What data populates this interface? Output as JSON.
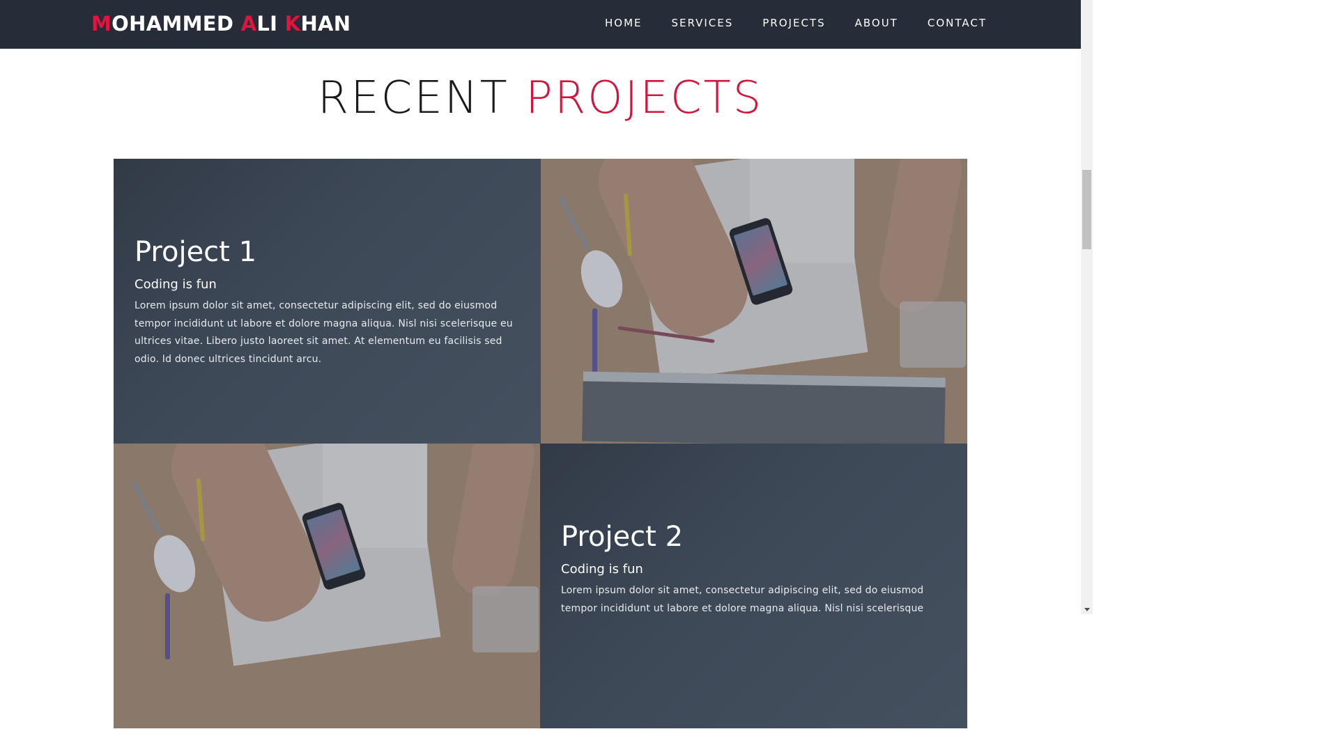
{
  "nav": {
    "brand": {
      "part1_accent": "M",
      "part1_rest": "OHAMMED ",
      "part2_accent": "A",
      "part2_rest": "LI ",
      "part3_accent": "K",
      "part3_rest": "HAN"
    },
    "links": [
      "HOME",
      "SERVICES",
      "PROJECTS",
      "ABOUT",
      "CONTACT"
    ]
  },
  "section": {
    "title_plain": "RECENT",
    "title_accent": "PROJECTS"
  },
  "projects": [
    {
      "title": "Project 1",
      "subtitle": "Coding is fun",
      "description": "Lorem ipsum dolor sit amet, consectetur adipiscing elit, sed do eiusmod tempor incididunt ut labore et dolore magna aliqua. Nisl nisi scelerisque eu ultrices vitae. Libero justo laoreet sit amet. At elementum eu facilisis sed odio. Id donec ultrices tincidunt arcu."
    },
    {
      "title": "Project 2",
      "subtitle": "Coding is fun",
      "description": "Lorem ipsum dolor sit amet, consectetur adipiscing elit, sed do eiusmod tempor incididunt ut labore et dolore magna aliqua. Nisl nisi scelerisque"
    }
  ],
  "colors": {
    "nav_bg": "#262d38",
    "accent": "#d2133a",
    "panel_bg": "#3e4958"
  }
}
